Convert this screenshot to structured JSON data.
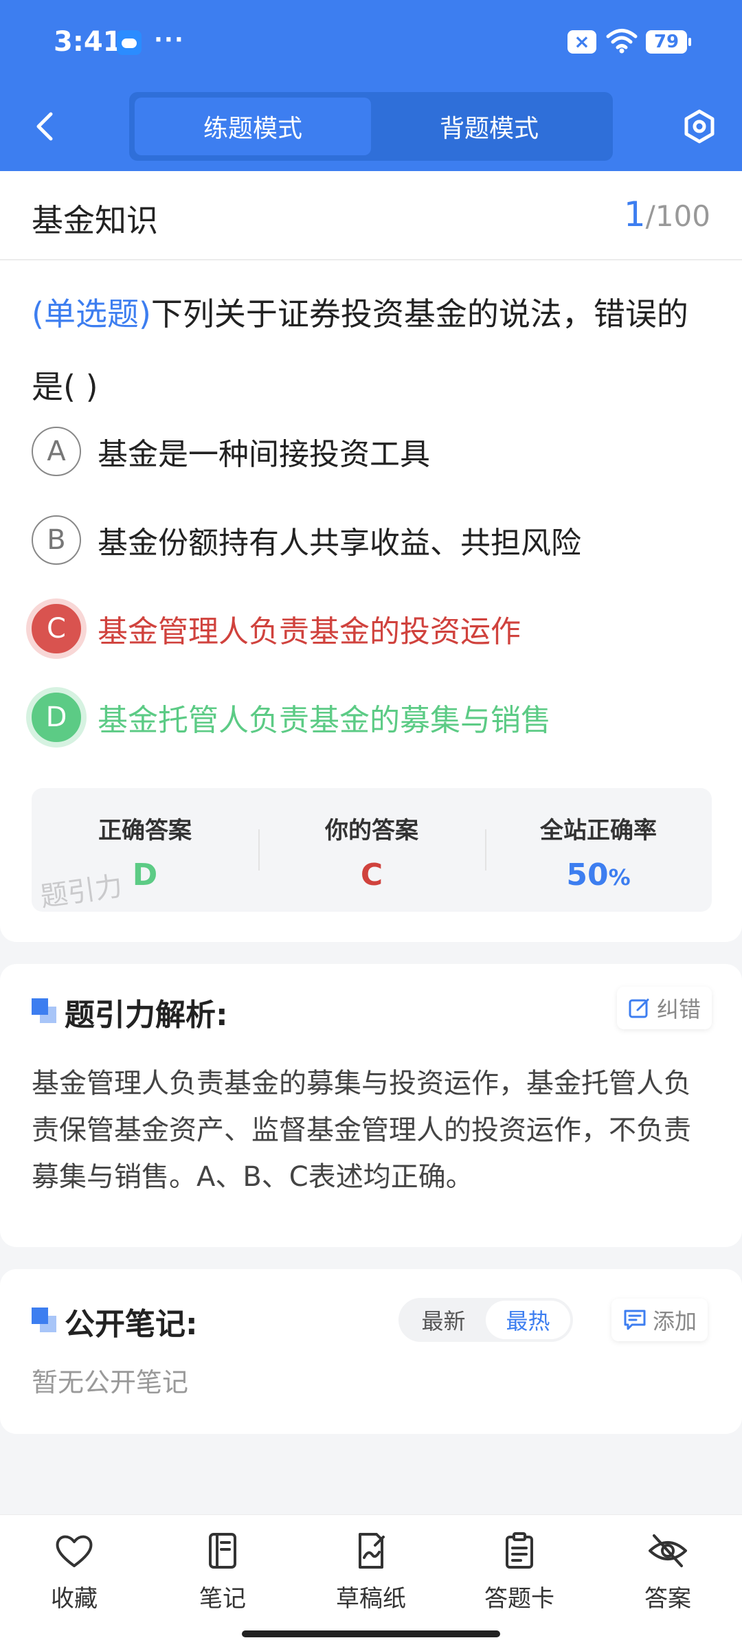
{
  "status_bar": {
    "time": "3:41",
    "dots": "···",
    "battery": "79"
  },
  "nav": {
    "modes": [
      {
        "label": "练题模式",
        "active": true
      },
      {
        "label": "背题模式",
        "active": false
      }
    ]
  },
  "question": {
    "subject": "基金知识",
    "current": "1",
    "total": "/100",
    "type": "(单选题)",
    "text": "下列关于证券投资基金的说法，错误的是(        )",
    "options": [
      {
        "letter": "A",
        "text": "基金是一种间接投资工具",
        "state": "normal"
      },
      {
        "letter": "B",
        "text": "基金份额持有人共享收益、共担风险",
        "state": "normal"
      },
      {
        "letter": "C",
        "text": "基金管理人负责基金的投资运作",
        "state": "wrong"
      },
      {
        "letter": "D",
        "text": "基金托管人负责基金的募集与销售",
        "state": "right"
      }
    ]
  },
  "result": {
    "correct_label": "正确答案",
    "correct_value": "D",
    "yours_label": "你的答案",
    "yours_value": "C",
    "rate_label": "全站正确率",
    "rate_value": "50",
    "rate_unit": "%",
    "watermark": "题引力"
  },
  "analysis": {
    "title": "题引力解析:",
    "report_label": "纠错",
    "text": "基金管理人负责基金的募集与投资运作，基金托管人负责保管基金资产、监督基金管理人的投资运作，不负责募集与销售。A、B、C表述均正确。"
  },
  "notes": {
    "title": "公开笔记:",
    "sort_newest": "最新",
    "sort_hottest": "最热",
    "add_label": "添加",
    "empty_text": "暂无公开笔记"
  },
  "bottom_bar": {
    "items": [
      {
        "label": "收藏",
        "icon": "heart-icon"
      },
      {
        "label": "笔记",
        "icon": "notebook-icon"
      },
      {
        "label": "草稿纸",
        "icon": "draft-icon"
      },
      {
        "label": "答题卡",
        "icon": "clipboard-icon"
      },
      {
        "label": "答案",
        "icon": "eye-off-icon"
      }
    ]
  },
  "colors": {
    "primary": "#3d7ef0",
    "wrong": "#d0423d",
    "right": "#5ccb85"
  }
}
